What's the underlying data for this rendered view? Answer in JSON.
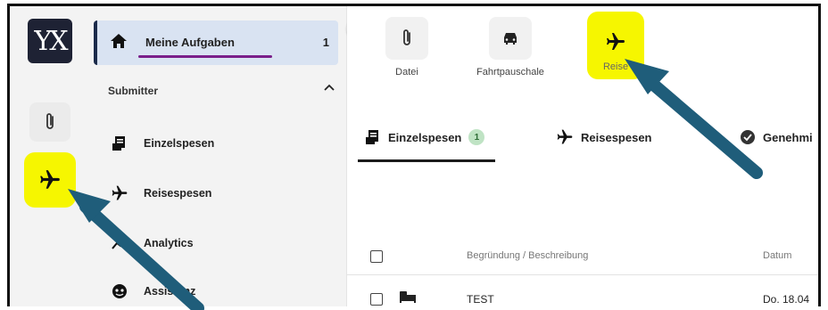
{
  "logo": {
    "text": "YX"
  },
  "rail": {
    "items": [
      {
        "icon": "paperclip-icon"
      },
      {
        "icon": "airplane-icon",
        "highlight": "#f6f600"
      }
    ]
  },
  "sidebar": {
    "active_item": {
      "label": "Meine Aufgaben",
      "count": "1",
      "icon": "home-icon"
    },
    "section": {
      "label": "Submitter",
      "icon": "chevron-up-icon"
    },
    "items": [
      {
        "label": "Einzelspesen",
        "icon": "receipt-icon"
      },
      {
        "label": "Reisespesen",
        "icon": "airplane-icon"
      },
      {
        "label": "Analytics",
        "icon": "analytics-icon"
      },
      {
        "label": "Assistenz",
        "icon": "assistant-icon"
      }
    ],
    "collapse_icon": "chevron-left-icon"
  },
  "main": {
    "tiles": [
      {
        "label": "Datei",
        "icon": "paperclip-icon"
      },
      {
        "label": "Fahrtpauschale",
        "icon": "car-icon"
      },
      {
        "label": "Reise",
        "icon": "airplane-icon",
        "highlight": "#f6f600"
      }
    ],
    "tabs": [
      {
        "label": "Einzelspesen",
        "badge": "1",
        "icon": "receipt-icon"
      },
      {
        "label": "Reisespesen",
        "icon": "airplane-icon"
      },
      {
        "label": "Genehmi",
        "icon": "check-circle-icon"
      }
    ],
    "table": {
      "columns": [
        "Begründung / Beschreibung",
        "Datum"
      ],
      "rows": [
        {
          "icon": "bed-icon",
          "description": "TEST",
          "date": "Do. 18.04"
        }
      ]
    }
  },
  "colors": {
    "highlight": "#f6f600",
    "arrow": "#1f5d7a",
    "accent_underline": "#7a1f8a",
    "logo_bg": "#1e2234"
  }
}
